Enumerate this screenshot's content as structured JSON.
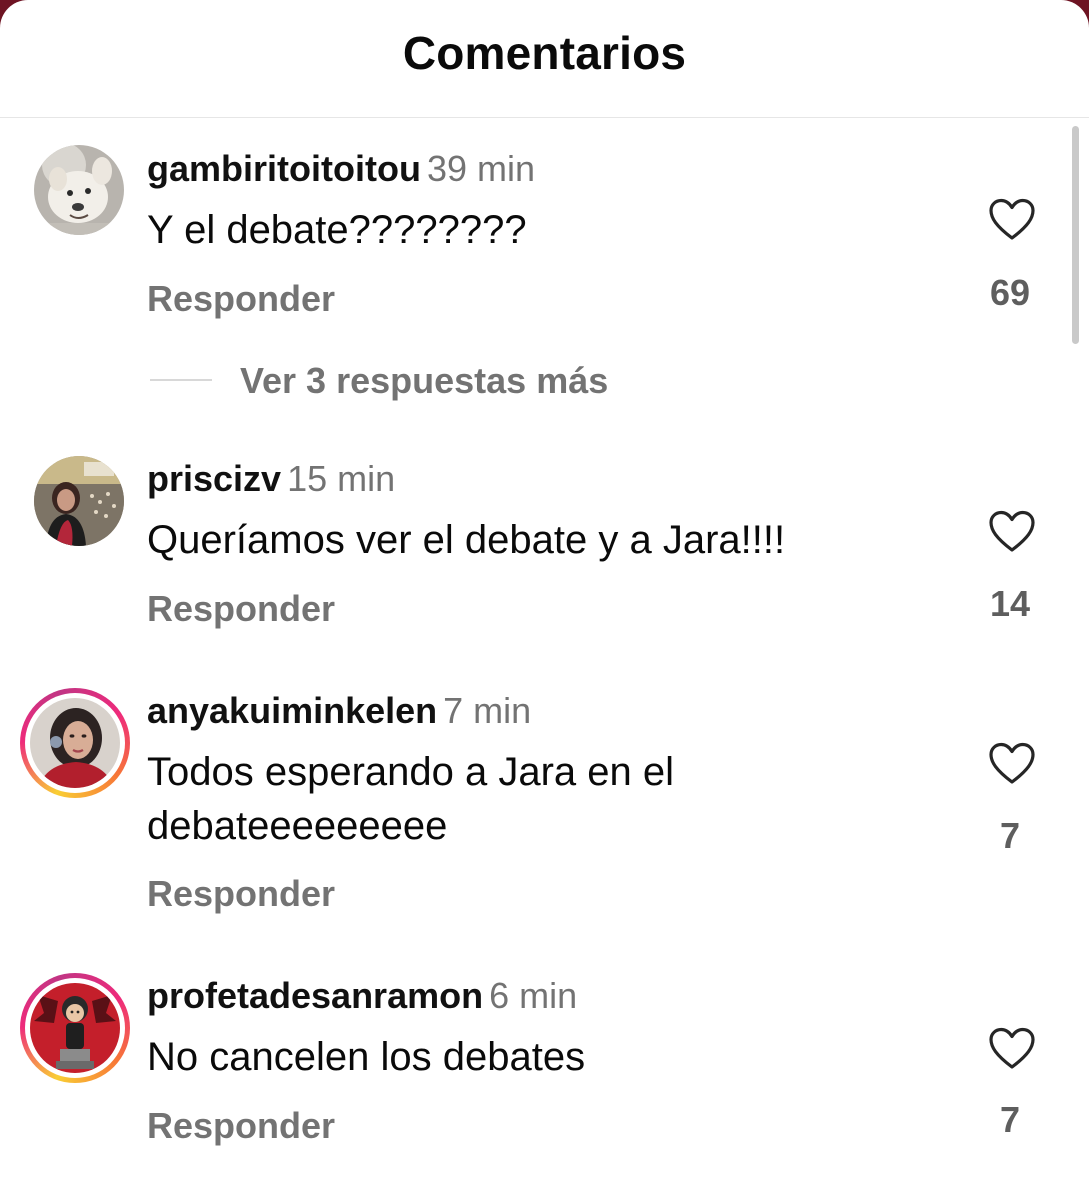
{
  "header": {
    "title": "Comentarios"
  },
  "comments": [
    {
      "username": "gambiritoitoitou",
      "time": "39 min",
      "text": "Y el debate????????",
      "reply_label": "Responder",
      "likes": "69",
      "avatar_icon": "dog-photo-avatar",
      "has_story_ring": false
    },
    {
      "username": "priscizv",
      "time": "15 min",
      "text": "Queríamos ver el debate y a Jara!!!!",
      "reply_label": "Responder",
      "likes": "14",
      "avatar_icon": "stadium-photo-avatar",
      "has_story_ring": false
    },
    {
      "username": "anyakuiminkelen",
      "time": "7 min",
      "text": "Todos esperando a Jara en el debateeeeeeeee",
      "reply_label": "Responder",
      "likes": "7",
      "avatar_icon": "woman-photo-avatar",
      "has_story_ring": true
    },
    {
      "username": "profetadesanramon",
      "time": "6 min",
      "text": "No cancelen los debates",
      "reply_label": "Responder",
      "likes": "7",
      "avatar_icon": "figure-on-red-avatar",
      "has_story_ring": true
    }
  ],
  "more_replies": {
    "label": "Ver 3 respuestas más"
  },
  "colors": {
    "background_frame": "#6e1423",
    "secondary_text": "#737373",
    "story_ring_start": "#f9ce34",
    "story_ring_end": "#ee2a7b"
  }
}
